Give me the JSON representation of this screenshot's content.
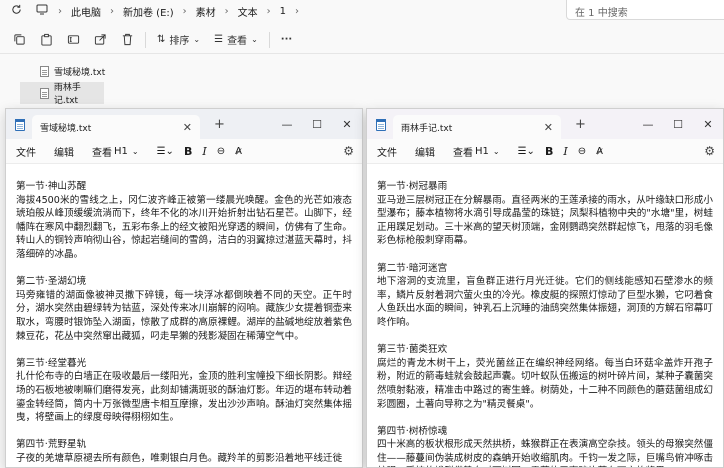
{
  "explorer": {
    "breadcrumbs": [
      "此电脑",
      "新加卷 (E:)",
      "素材",
      "文本",
      "1"
    ],
    "search_placeholder": "在 1 中搜索",
    "commands": {
      "sort": "排序",
      "view": "查看",
      "more": "···"
    },
    "files": [
      {
        "name": "雪域秘境.txt",
        "selected": false
      },
      {
        "name": "雨林手记.txt",
        "selected": true
      }
    ]
  },
  "notepad_left": {
    "tab_title": "雪域秘境.txt",
    "menu": {
      "file": "文件",
      "edit": "编辑",
      "view": "查看",
      "heading": "H1"
    },
    "sections": [
      {
        "title": "第一节·神山苏醒",
        "text": "海拔4500米的雪线之上，冈仁波齐峰正被第一缕晨光唤醒。金色的光芒如液态琥珀般从峰顶缓缓流淌而下，终年不化的冰川开始折射出钻石星芒。山脚下，经幡阵在寒风中翻烈翻飞，五彩布条上的经文被阳光穿透的瞬间，仿佛有了生命。转山人的铜铃声响彻山谷，惊起岩缝间的雪鸽，洁白的羽翼掠过湛蓝天幕时，抖落细碎的冰晶。"
      },
      {
        "title": "第二节·圣湖幻境",
        "text": "玛旁雍错的湖面像被神灵撒下碎镜，每一块浮冰都倒映着不同的天空。正午时分，湖水突然由碧绿转为钴蓝，深处传来冰川崩解的闷响。藏族少女提着铜壶来取水，弯腰时银饰坠入湖面，惊散了成群的高原裸鲤。湖岸的盐碱地绽放着紫色棘豆花，花丛中突然窜出藏狐，叼走旱獭的残影凝固在稀薄空气中。"
      },
      {
        "title": "第三节·经堂暮光",
        "text": "扎什伦布寺的白墙正在吸收最后一缕阳光，金顶的胜利宝幢投下细长阴影。辩经场的石板地被喇嘛们磨得发亮，此刻却铺满斑驳的酥油灯影。年迈的堪布转动着鎏金转经筒，筒内十万张微型唐卡相互摩擦，发出沙沙声响。酥油灯突然集体摇曳，将壁画上的绿度母映得栩栩如生。"
      },
      {
        "title": "第四节·荒野星轨",
        "text": "子夜的羌塘草原褪去所有颜色，唯剩银白月色。藏羚羊的剪影沿着地平线迁徙"
      }
    ]
  },
  "notepad_right": {
    "tab_title": "雨林手记.txt",
    "menu": {
      "file": "文件",
      "edit": "编辑",
      "view": "查看",
      "heading": "H1"
    },
    "sections": [
      {
        "title": "第一节·树冠暴雨",
        "text": "亚马逊三层树冠正在分解暴雨。直径两米的王莲承接的雨水，从叶缘缺口形成小型瀑布；藤本植物将水滴引导成晶莹的珠链；凤梨科植物中央的\"水塘\"里，树蛙正用蹼足划动。三十米高的望天树顶端，金刚鹦鹉突然群起惊飞，甩落的羽毛像彩色标枪般刺穿雨幕。"
      },
      {
        "title": "第二节·暗河迷宫",
        "text": "地下溶洞的支流里，盲鱼群正进行月光迁徙。它们的侧线能感知石壁渗水的频率，鳞片反射着洞穴萤火虫的冷光。橡皮艇的探照灯惊动了巨型水獭，它叼着食人鱼跃出水面的瞬间，钟乳石上沉睡的油鸱突然集体振翅，洞顶的方解石帘幕叮咚作响。"
      },
      {
        "title": "第三节·菌类狂欢",
        "text": "腐烂的青龙木树干上，荧光菌丝正在编织神经网络。每当白环菇伞盖炸开孢子粉，附近的箭毒蛙就会鼓起声囊。切叶蚁队伍搬运的树叶碎片间，某种子囊菌突然喷射黏液，精准击中路过的寄生蜂。树荫处，十二种不同颜色的蘑菇菌组成幻彩圆圈，土著向导称之为\"精灵餐桌\"。"
      },
      {
        "title": "第四节·树桥惊魂",
        "text": "四十米高的板状根形成天然拱桥，蛛猴群正在表演高空杂技。领头的母猴突然僵住——藤蔓间伪装成树皮的森蚺开始收缩肌肉。千钧一发之际，巨嘴鸟俯冲啄击蛇眼，受惊的蜷群借势向对面树冠。雾薄的甲壳碎片落在下方的浆果"
      }
    ]
  }
}
